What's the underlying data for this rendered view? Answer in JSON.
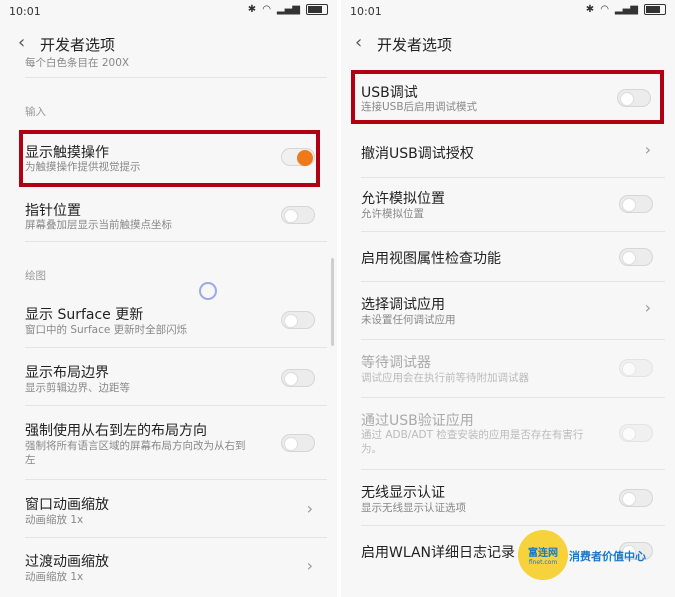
{
  "status": {
    "time": "10:01"
  },
  "title": "开发者选项",
  "left": {
    "partial_top": "每个白色条目在 200X",
    "section_input": "输入",
    "section_draw": "绘图",
    "items": [
      {
        "label": "显示触摸操作",
        "sub": "为触摸操作提供视觉提示",
        "control": "toggle-on"
      },
      {
        "label": "指针位置",
        "sub": "屏幕叠加层显示当前触摸点坐标",
        "control": "toggle-off"
      },
      {
        "label": "显示 Surface 更新",
        "sub": "窗口中的 Surface 更新时全部闪烁",
        "control": "toggle-off"
      },
      {
        "label": "显示布局边界",
        "sub": "显示剪辑边界、边距等",
        "control": "toggle-off"
      },
      {
        "label": "强制使用从右到左的布局方向",
        "sub": "强制将所有语言区域的屏幕布局方向改为从右到",
        "sub2": "左",
        "control": "toggle-off"
      },
      {
        "label": "窗口动画缩放",
        "sub": "动画缩放 1x",
        "control": "chevron"
      },
      {
        "label": "过渡动画缩放",
        "sub": "动画缩放 1x",
        "control": "chevron"
      }
    ]
  },
  "right": {
    "items": [
      {
        "label": "USB调试",
        "sub": "连接USB后启用调试模式",
        "control": "toggle-off"
      },
      {
        "label": "撤消USB调试授权",
        "control": "chevron"
      },
      {
        "label": "允许模拟位置",
        "sub": "允许模拟位置",
        "control": "toggle-off"
      },
      {
        "label": "启用视图属性检查功能",
        "control": "toggle-off"
      },
      {
        "label": "选择调试应用",
        "sub": "未设置任何调试应用",
        "control": "chevron"
      },
      {
        "label": "等待调试器",
        "sub": "调试应用会在执行前等待附加调试器",
        "control": "toggle-off"
      },
      {
        "label": "通过USB验证应用",
        "sub": "通过 ADB/ADT 检查安装的应用是否存在有害行",
        "sub2": "为。",
        "control": "toggle-off"
      },
      {
        "label": "无线显示认证",
        "sub": "显示无线显示认证选项",
        "control": "toggle-off"
      },
      {
        "label": "启用WLAN详细日志记录",
        "control": "toggle-off"
      }
    ]
  },
  "watermark": {
    "logo_text": "富连网",
    "logo_sub": "flnet.com",
    "text": "消费者价值中心"
  },
  "colors": {
    "accent": "#ef7a1a",
    "highlight": "#b00012"
  }
}
